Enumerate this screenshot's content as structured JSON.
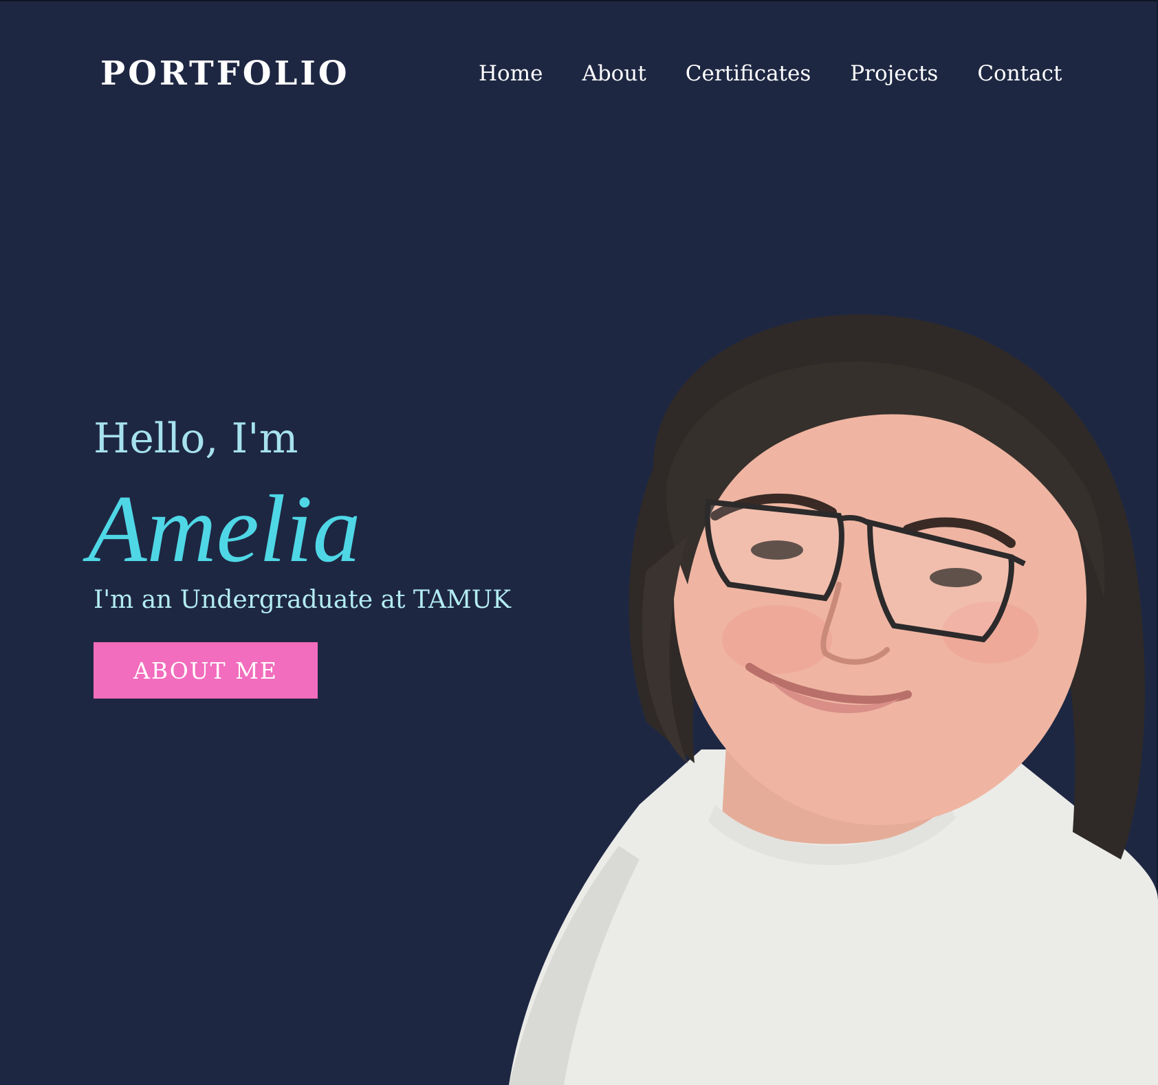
{
  "header": {
    "brand": "PORTFOLIO",
    "nav": [
      {
        "label": "Home"
      },
      {
        "label": "About"
      },
      {
        "label": "Certificates"
      },
      {
        "label": "Projects"
      },
      {
        "label": "Contact"
      }
    ]
  },
  "hero": {
    "greeting": "Hello, I'm",
    "name": "Amelia",
    "tagline": "I'm an Undergraduate at TAMUK",
    "cta_label": "ABOUT ME"
  },
  "colors": {
    "background": "#1e2742",
    "accent_cyan": "#4fd7e6",
    "light_cyan": "#a6e2ee",
    "button_pink": "#f26dbd",
    "nav_text": "#ffffff"
  },
  "images": {
    "portrait": "portrait-photo"
  }
}
